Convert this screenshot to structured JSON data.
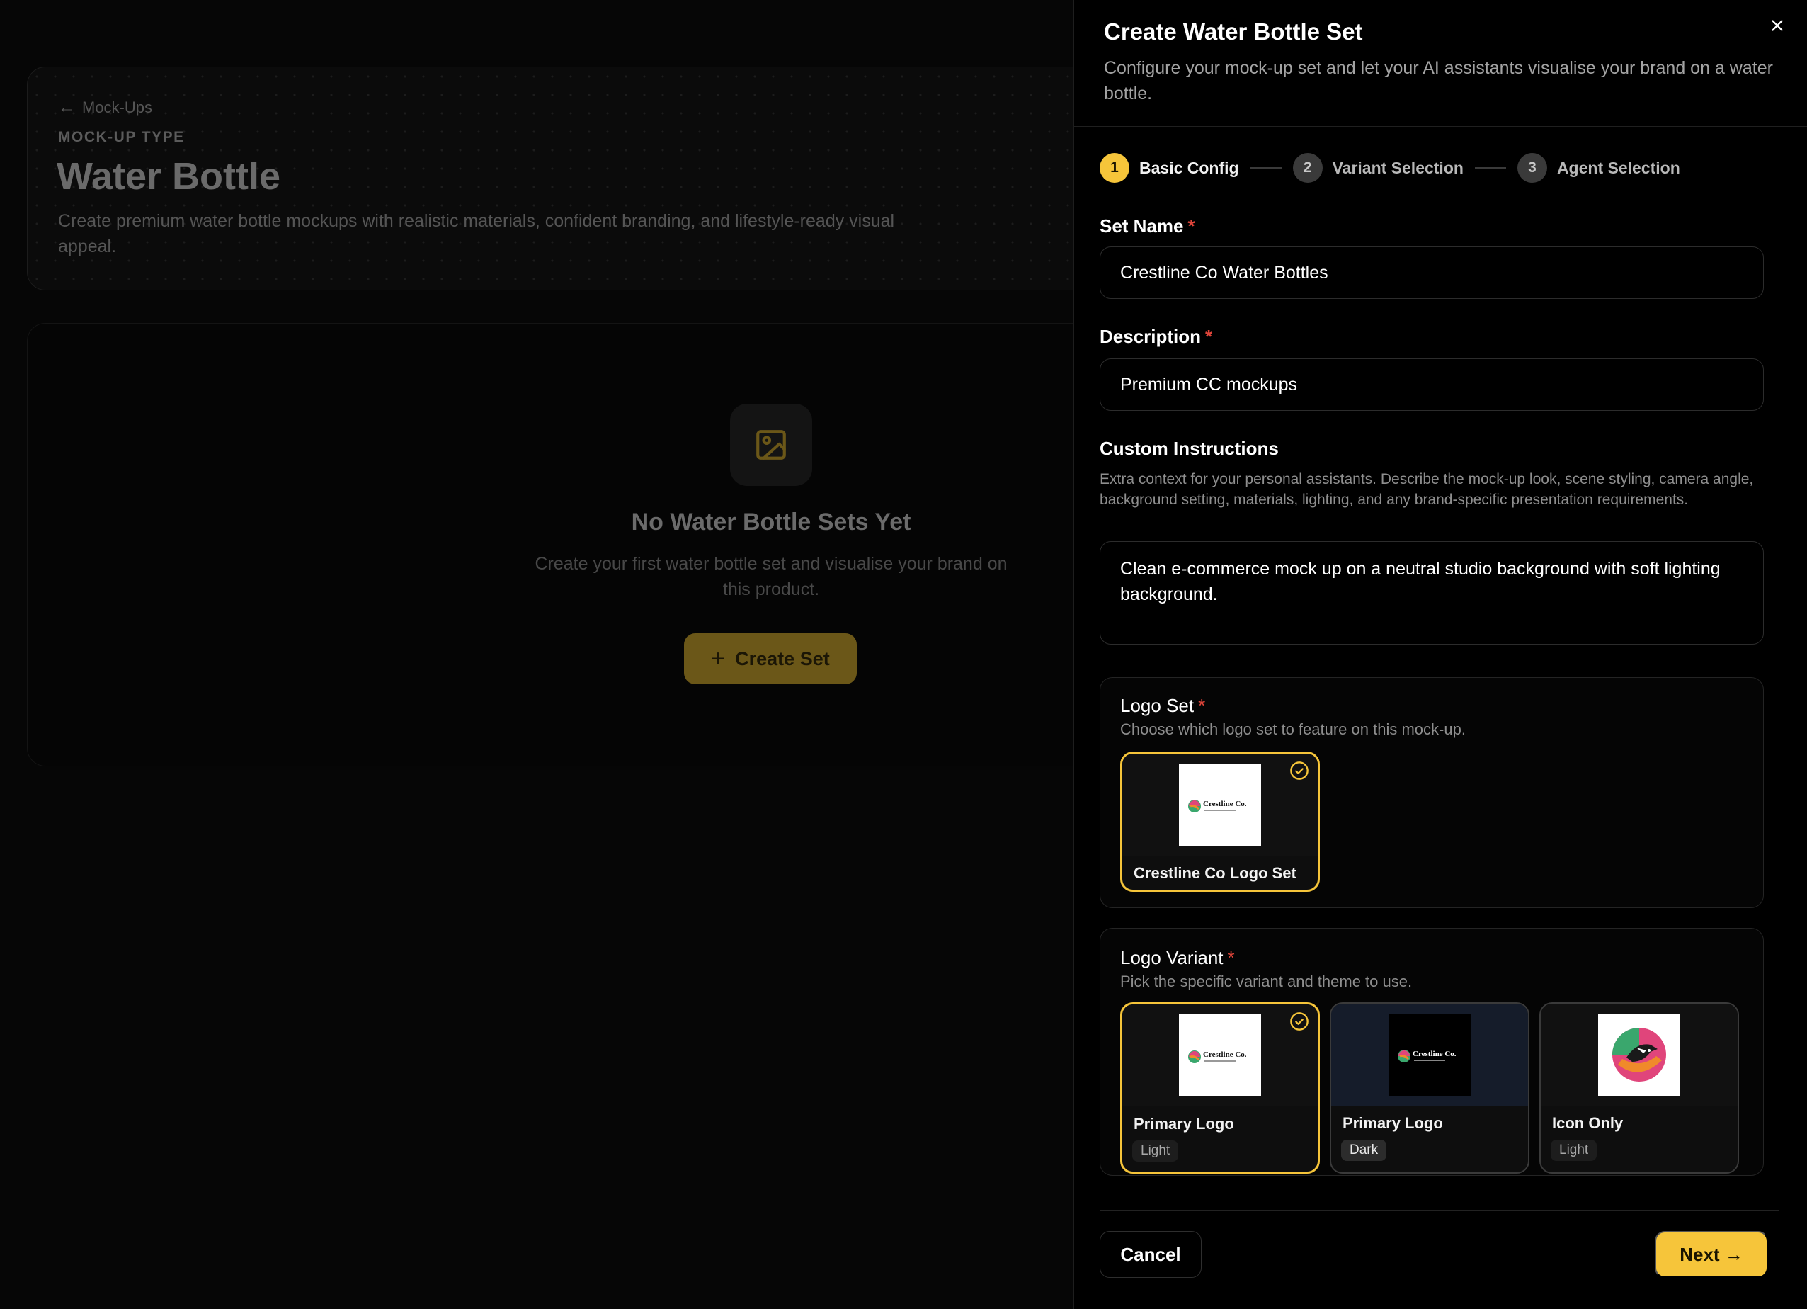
{
  "background": {
    "back_link": "Mock-Ups",
    "eyebrow": "MOCK-UP TYPE",
    "title": "Water Bottle",
    "description": "Create premium water bottle mockups with realistic materials, confident branding, and lifestyle-ready visual appeal.",
    "empty_title": "No Water Bottle Sets Yet",
    "empty_description": "Create your first water bottle set and visualise your brand on this product.",
    "create_button": "Create Set"
  },
  "drawer": {
    "title": "Create Water Bottle Set",
    "subtitle": "Configure your mock-up set and let your AI assistants visualise your brand on a water bottle.",
    "steps": [
      {
        "num": "1",
        "label": "Basic Config"
      },
      {
        "num": "2",
        "label": "Variant Selection"
      },
      {
        "num": "3",
        "label": "Agent Selection"
      }
    ],
    "set_name": {
      "label": "Set Name",
      "value": "Crestline Co Water Bottles"
    },
    "description": {
      "label": "Description",
      "value": "Premium CC mockups"
    },
    "custom_instructions": {
      "label": "Custom Instructions",
      "help": "Extra context for your personal assistants. Describe the mock-up look, scene styling, camera angle, background setting, materials, lighting, and any brand-specific presentation requirements.",
      "value": "Clean e-commerce mock up on a neutral studio background with soft lighting background."
    },
    "logo_set": {
      "label": "Logo Set",
      "help": "Choose which logo set to feature on this mock-up.",
      "options": [
        {
          "name": "Crestline Co Logo Set"
        }
      ]
    },
    "logo_variant": {
      "label": "Logo Variant",
      "help": "Pick the specific variant and theme to use.",
      "options": [
        {
          "name": "Primary Logo",
          "theme": "Light"
        },
        {
          "name": "Primary Logo",
          "theme": "Dark"
        },
        {
          "name": "Icon Only",
          "theme": "Light"
        }
      ]
    },
    "logo_wordmark": "Crestline Co.",
    "cancel": "Cancel",
    "next": "Next →"
  },
  "colors": {
    "accent": "#f6c53a",
    "required": "#e0453a"
  }
}
